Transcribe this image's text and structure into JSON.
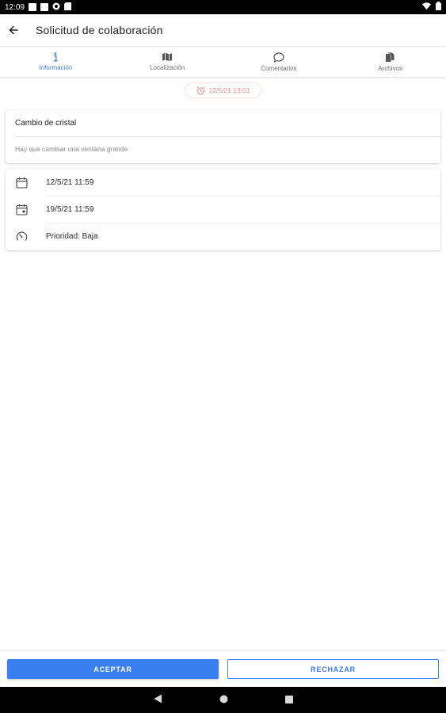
{
  "status_bar": {
    "time": "12:09"
  },
  "app_bar": {
    "title": "Solicitud de colaboración"
  },
  "tabs": [
    {
      "label": "Información",
      "icon": "info-icon",
      "active": true
    },
    {
      "label": "Localización",
      "icon": "map-icon",
      "active": false
    },
    {
      "label": "Comentarios",
      "icon": "comment-icon",
      "active": false
    },
    {
      "label": "Archivos",
      "icon": "files-icon",
      "active": false
    }
  ],
  "date_chip": {
    "text": "12/5/21 13:01",
    "icon": "alarm-icon"
  },
  "description": {
    "title": "Cambio de cristal",
    "text": "Hay que cambiar una ventana grande"
  },
  "info": [
    {
      "icon": "calendar-icon",
      "text": "12/5/21 11:59"
    },
    {
      "icon": "calendar-end-icon",
      "text": "19/5/21 11:59"
    },
    {
      "icon": "speedometer-icon",
      "text": "Prioridad: Baja"
    }
  ],
  "actions": {
    "accept": "ACEPTAR",
    "reject": "RECHAZAR"
  },
  "colors": {
    "accent": "#3a7ff2",
    "chip": "#f28a8a"
  }
}
